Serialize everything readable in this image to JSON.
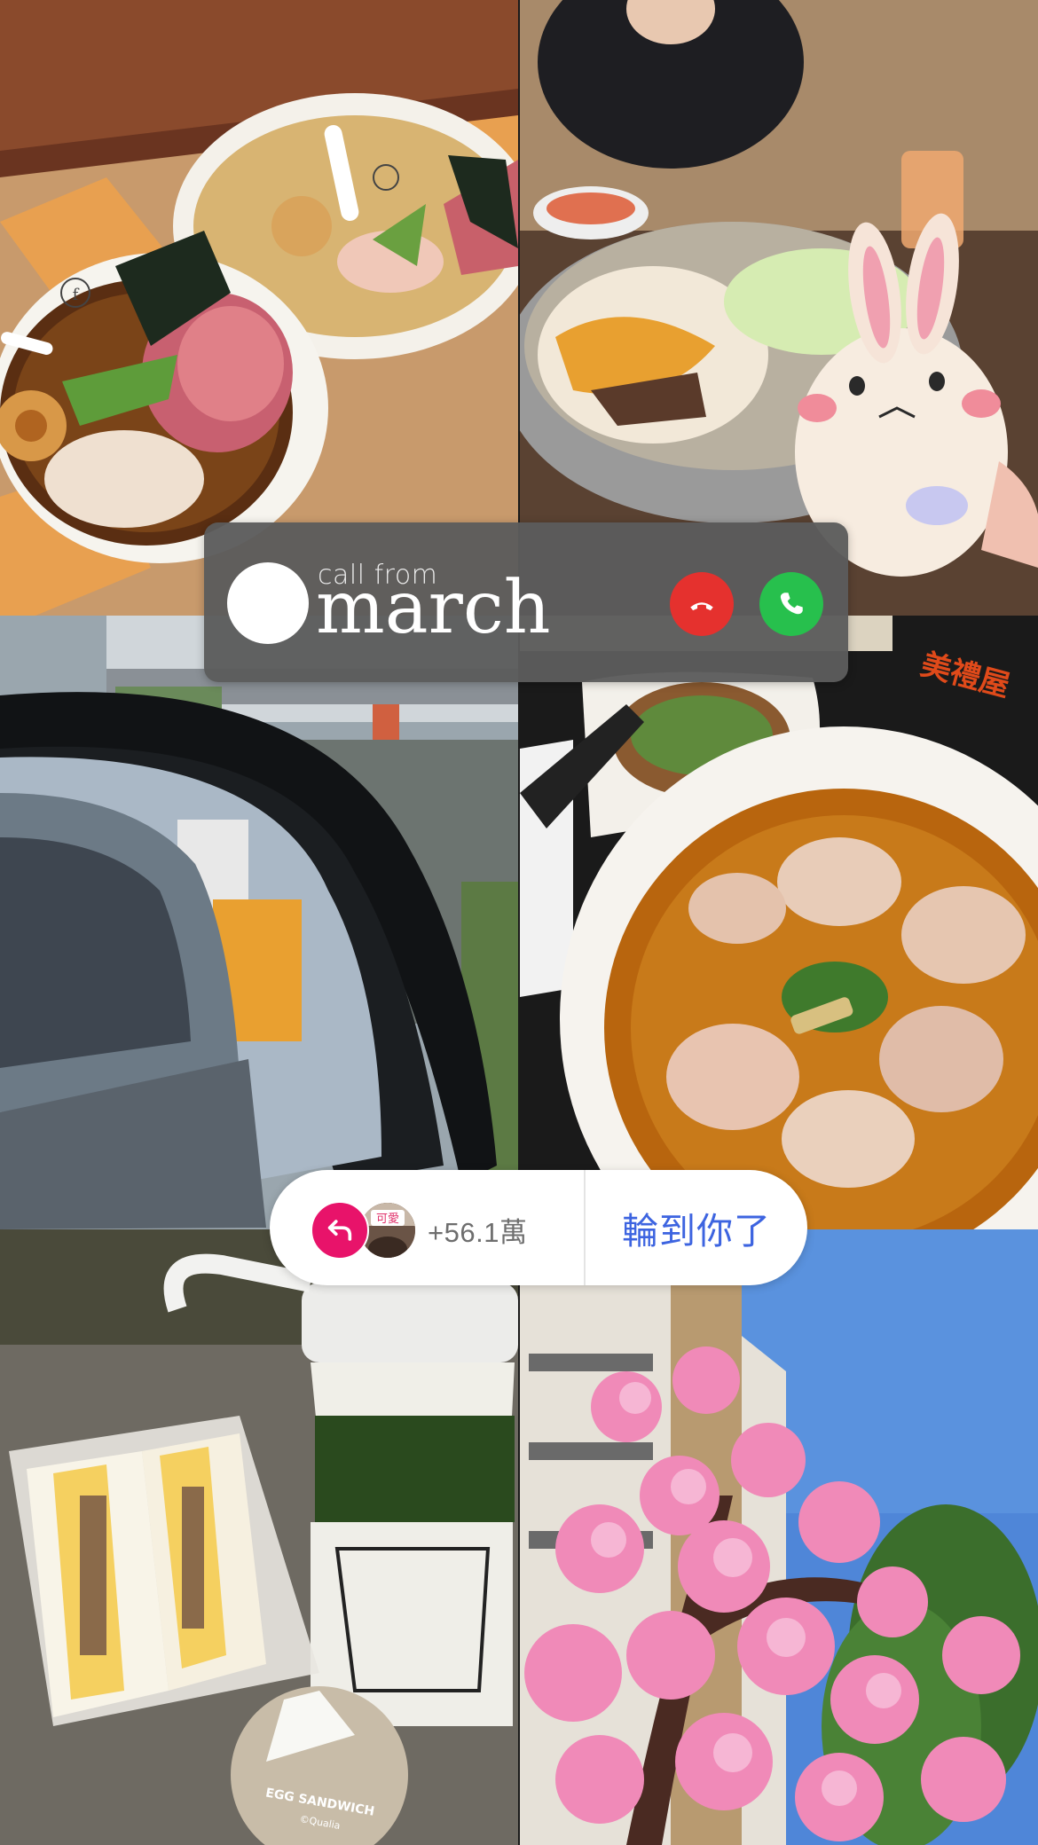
{
  "call_banner": {
    "from_label": "call from",
    "caller_name": "march",
    "decline_color": "#e5312e",
    "accept_color": "#27c04d",
    "decline_icon": "phone-hangup-icon",
    "accept_icon": "phone-icon"
  },
  "reply_pill": {
    "icon": "reply-arrow-icon",
    "icon_color": "#e8136a",
    "avatar_badge": "可愛",
    "count": "+56.1萬",
    "action_label": "輪到你了",
    "action_color": "#3d64e0"
  },
  "photos": {
    "ramen": {
      "bowl_logo": "f"
    },
    "bowl": {
      "shop_name": "美禮屋"
    },
    "sandwich": {
      "badge_title": "EGG SANDWICH",
      "badge_sub": "©Qualia"
    }
  }
}
